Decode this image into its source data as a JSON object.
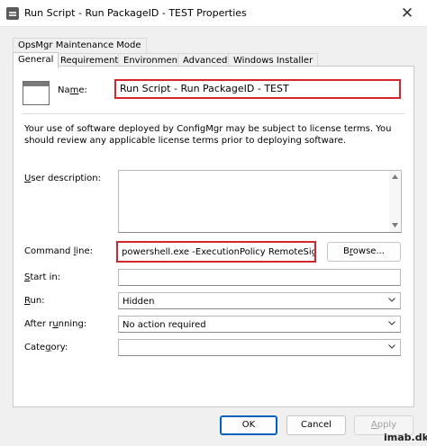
{
  "window": {
    "title": "Run Script - Run PackageID - TEST Properties",
    "close_glyph": "✕"
  },
  "tabs_row1": [
    {
      "label": "OpsMgr Maintenance Mode"
    }
  ],
  "tabs_row2": [
    {
      "label": "General",
      "active": true
    },
    {
      "label": "Requirements"
    },
    {
      "label": "Environment"
    },
    {
      "label": "Advanced"
    },
    {
      "label": "Windows Installer"
    }
  ],
  "general": {
    "name_label_pre": "Na",
    "name_label_u": "m",
    "name_label_post": "e:",
    "name_value": "Run Script - Run PackageID - TEST",
    "notice": "Your use of software deployed by ConfigMgr may be subject to license terms. You should review any applicable license terms prior to deploying software.",
    "user_description_label_u": "U",
    "user_description_label_post": "ser description:",
    "user_description_value": "",
    "command_line_label_pre": "Command ",
    "command_line_label_u": "l",
    "command_line_label_post": "ine:",
    "command_line_value": "powershell.exe -ExecutionPolicy RemoteSigned -",
    "browse_label_pre": "B",
    "browse_label_u": "r",
    "browse_label_post": "owse...",
    "start_in_label_u": "S",
    "start_in_label_post": "tart in:",
    "start_in_value": "",
    "run_label_u": "R",
    "run_label_post": "un:",
    "run_value": "Hidden",
    "after_running_label_pre": "After r",
    "after_running_label_u": "u",
    "after_running_label_post": "nning:",
    "after_running_value": "No action required",
    "category_label_pre": "Cate",
    "category_label_u": "g",
    "category_label_post": "ory:",
    "category_value": ""
  },
  "buttons": {
    "ok": "OK",
    "cancel": "Cancel",
    "apply_u": "A",
    "apply_post": "pply"
  },
  "watermark": "imab.dk",
  "colors": {
    "highlight_red": "#d6262b",
    "accent_blue": "#005fb8"
  }
}
